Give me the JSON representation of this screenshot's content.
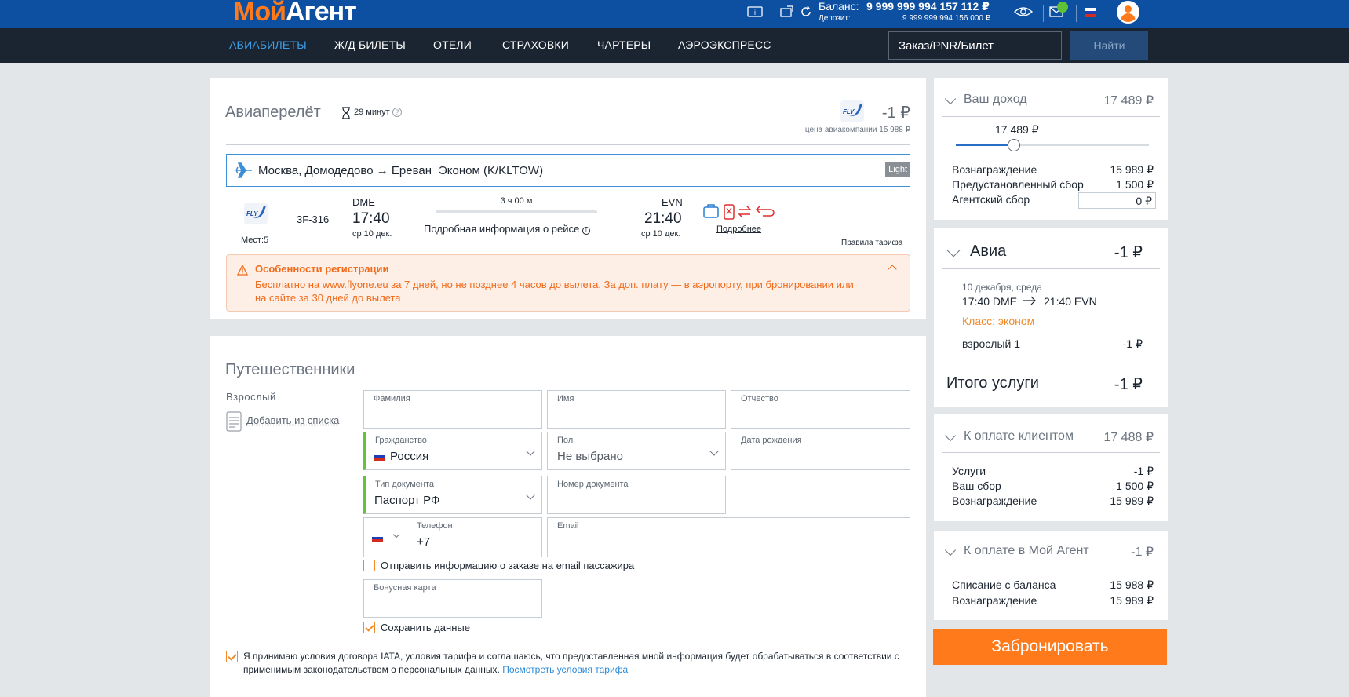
{
  "header": {
    "logo_part1": "Мой",
    "logo_part2": "Агент",
    "balance_label": "Баланс:",
    "balance_value": "9 999 999 994 157 112 ₽",
    "deposit_label": "Депозит:",
    "deposit_value": "9 999 999 994 156 000 ₽"
  },
  "nav": {
    "items": [
      "АВИАБИЛЕТЫ",
      "Ж/Д БИЛЕТЫ",
      "ОТЕЛИ",
      "СТРАХОВКИ",
      "ЧАРТЕРЫ",
      "АЭРОЭКСПРЕСС"
    ],
    "active_index": 0,
    "search_value": "Заказ/PNR/Билет",
    "search_button": "Найти"
  },
  "flight": {
    "title": "Авиаперелёт",
    "timer": "29 минут",
    "price": "-1 ₽",
    "airline_price": "цена авиакомпании 15 988 ₽",
    "route": "Москва, Домодедово → Ереван",
    "cabin": "Эконом (K/KLTOW)",
    "fare_badge": "Light",
    "seats": "Мест:5",
    "flight_number": "3F-316",
    "dep_code": "DME",
    "dep_time": "17:40",
    "dep_date": "ср 10 дек.",
    "duration": "3 ч 00 м",
    "details_info": "Подробная информация о рейсе",
    "arr_code": "EVN",
    "arr_time": "21:40",
    "arr_date": "ср 10 дек.",
    "more_link": "Подробнее",
    "fare_rules": "Правила тарифа",
    "airline_logo_text": "FLY",
    "reg_title": "Особенности регистрации",
    "reg_text": "Бесплатно на www.flyone.eu за 7 дней, но не позднее 4 часов до вылета. За доп. плату — в аэропорту, при бронировании или на сайте за 30 дней до вылета"
  },
  "travellers": {
    "title": "Путешественники",
    "type": "Взрослый",
    "add_from_list": "Добавить из списка",
    "fields": {
      "surname_label": "Фамилия",
      "name_label": "Имя",
      "patronymic_label": "Отчество",
      "citizenship_label": "Гражданство",
      "citizenship_value": "Россия",
      "gender_label": "Пол",
      "gender_value": "Не выбрано",
      "birthdate_label": "Дата рождения",
      "doc_type_label": "Тип документа",
      "doc_type_value": "Паспорт РФ",
      "doc_number_label": "Номер документа",
      "phone_label": "Телефон",
      "phone_value": "+7",
      "email_label": "Email",
      "bonus_label": "Бонусная карта"
    },
    "send_email_label": "Отправить информацию о заказе на email пассажира",
    "save_data_label": "Сохранить данные",
    "terms_text": "Я принимаю условия договора IATA, условия тарифа и соглашаюсь, что предоставленная мной информация будет обрабатываться в соответствии с применимым законодательством о персональных данных.",
    "terms_link": "Посмотреть условия тарифа"
  },
  "income": {
    "title": "Ваш доход",
    "total": "17 489 ₽",
    "slider_value_text": "17 489 ₽",
    "slider_fraction": 0.3,
    "reward_label": "Вознаграждение",
    "reward_value": "15 989 ₽",
    "preset_fee_label": "Предустановленный сбор",
    "preset_fee_value": "1 500 ₽",
    "agent_fee_label": "Агентский сбор",
    "agent_fee_value": "0",
    "agent_fee_currency": "₽"
  },
  "avia": {
    "title": "Авиа",
    "total": "-1 ₽",
    "date": "10 декабря, среда",
    "dep": "17:40 DME",
    "arr": "21:40 EVN",
    "class": "Класс: эконом",
    "pax_label": "взрослый 1",
    "pax_value": "-1 ₽",
    "services_total_label": "Итого услуги",
    "services_total_value": "-1 ₽"
  },
  "client_pay": {
    "title": "К оплате клиентом",
    "total": "17 488 ₽",
    "rows": [
      {
        "label": "Услуги",
        "value": "-1 ₽"
      },
      {
        "label": "Ваш сбор",
        "value": "1 500 ₽"
      },
      {
        "label": "Вознаграждение",
        "value": "15 989 ₽"
      }
    ]
  },
  "agent_pay": {
    "title": "К оплате в Мой Агент",
    "total": "-1 ₽",
    "rows": [
      {
        "label": "Списание с баланса",
        "value": "15 988 ₽"
      },
      {
        "label": "Вознаграждение",
        "value": "15 989 ₽"
      }
    ]
  },
  "book_button": "Забронировать",
  "colors": {
    "brand_blue": "#0d4fa0",
    "nav_dark": "#1b2532",
    "accent_orange": "#ff7a1a",
    "link_blue": "#3d9ee8"
  }
}
